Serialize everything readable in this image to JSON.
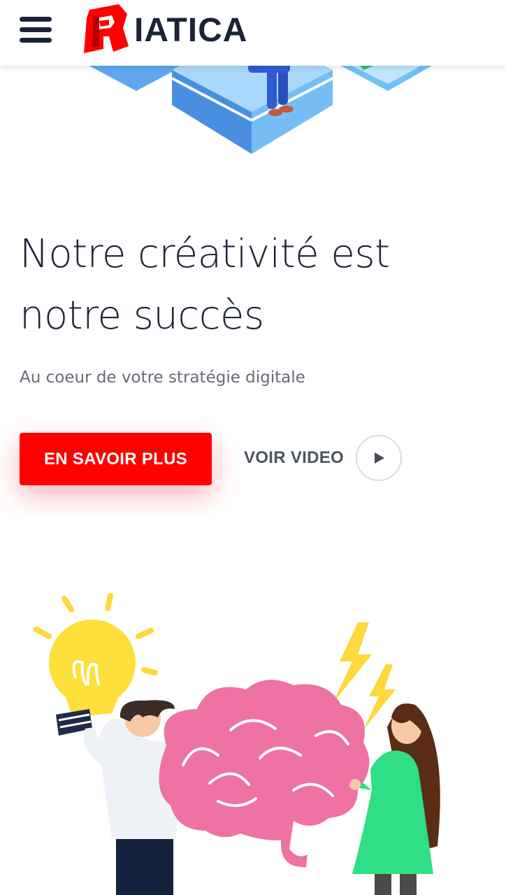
{
  "header": {
    "menu_icon": "hamburger-menu-icon",
    "logo_text": "IATICA",
    "logo_letter": "R",
    "brand_color": "#fe0000"
  },
  "hero": {
    "title": "Notre créativité est notre succès",
    "subtitle": "Au coeur de votre stratégie digitale",
    "primary_button": "EN SAVOIR PLUS",
    "video_label": "VOIR VIDEO",
    "video_icon": "play-icon"
  },
  "colors": {
    "text_dark": "#1e2539",
    "text_muted": "#646b78",
    "accent": "#fe0000"
  }
}
